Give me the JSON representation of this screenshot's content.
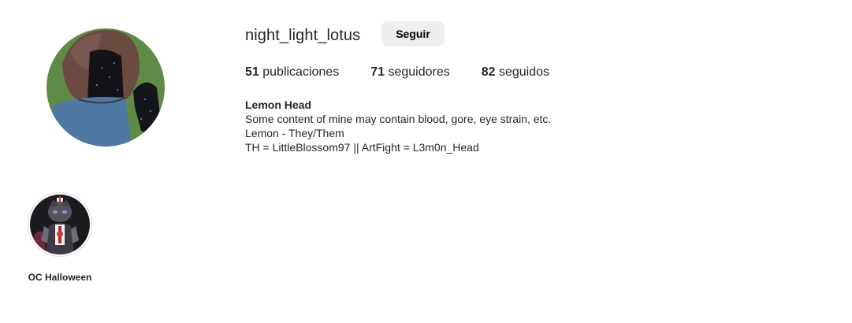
{
  "profile": {
    "username": "night_light_lotus",
    "follow_label": "Seguir",
    "avatar_icon": "profile-avatar",
    "stats": {
      "posts_count": "51",
      "posts_label": "publicaciones",
      "followers_count": "71",
      "followers_label": "seguidores",
      "following_count": "82",
      "following_label": "seguidos"
    },
    "bio": {
      "name": "Lemon Head",
      "lines": [
        "Some content of mine may contain blood, gore, eye strain, etc.",
        "Lemon - They/Them",
        "TH = LittleBlossom97 || ArtFight = L3m0n_Head"
      ]
    }
  },
  "highlights": [
    {
      "label": "OC Halloween"
    }
  ],
  "colors": {
    "avatar_bg": "#5e8a45",
    "hair": "#6b4a42",
    "shirt": "#4f79a3",
    "button_bg": "#efefef"
  }
}
